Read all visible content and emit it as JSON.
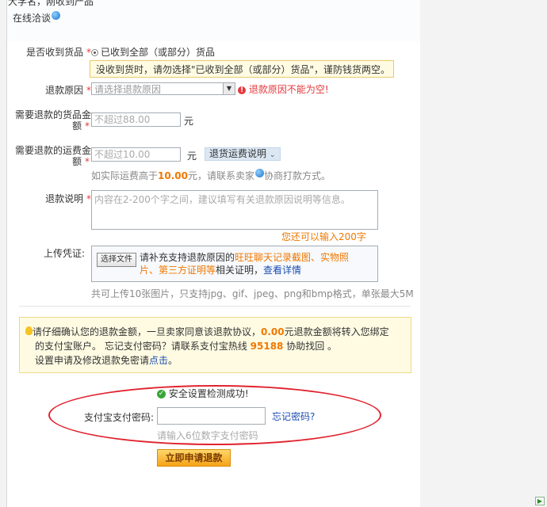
{
  "top": {
    "cut_text": "大学名，刚收到产品",
    "online_label": "在线洽谈"
  },
  "form": {
    "received": {
      "label": "是否收到货品",
      "option": "已收到全部（或部分）货品",
      "tip": "没收到货时，请勿选择\"已收到全部（或部分）货品\"，谨防钱货两空。"
    },
    "reason": {
      "label": "退款原因",
      "placeholder": "请选择退款原因",
      "error": "退款原因不能为空!"
    },
    "goods_amount": {
      "label_line1": "需要退款的货品金",
      "label_line2": "额",
      "placeholder": "不超过88.00",
      "unit": "元"
    },
    "shipping_amount": {
      "label_line1": "需要退款的运费金",
      "label_line2": "额",
      "placeholder": "不超过10.00",
      "unit": "元",
      "dropdown_label": "退货运费说明",
      "hint_prefix": "如实际运费高于",
      "hint_value": "10.00",
      "hint_unit": "元，请联系卖家",
      "hint_suffix": "协商打款方式。"
    },
    "description": {
      "label": "退款说明",
      "placeholder": "内容在2-200个字之间，建议填写有关退款原因说明等信息。",
      "counter": "您还可以输入200字"
    },
    "upload": {
      "label": "上传凭证:",
      "button": "选择文件",
      "text_prefix": "请补充支持退款原因的",
      "text_highlight_1": "旺旺聊天记录截图、实物照",
      "text_highlight_2": "片、第三方证明等",
      "text_mid": "相关证明，",
      "text_link": "查看详情",
      "limit": "共可上传10张图片，只支持jpg、gif、jpeg、png和bmp格式，单张最大5M"
    }
  },
  "notice": {
    "line1_prefix": "请仔细确认您的退款金额，一旦卖家同意该退款协议，",
    "amount": "0.00",
    "line1_suffix": "元退款金额将转入您绑定",
    "line2_prefix": "的支付宝账户。 忘记支付密码？请联系支付宝热线",
    "hotline": "95188",
    "line2_suffix": "协助找回 。",
    "line3_prefix": "设置申请及修改退款免密请",
    "line3_link": "点击",
    "line3_suffix": "。"
  },
  "security": {
    "check_text": "安全设置检测成功!",
    "pwd_label": "支付宝支付密码:",
    "forgot": "忘记密码?",
    "pwd_hint": "请输入6位数字支付密码",
    "submit": "立即申请退款"
  }
}
